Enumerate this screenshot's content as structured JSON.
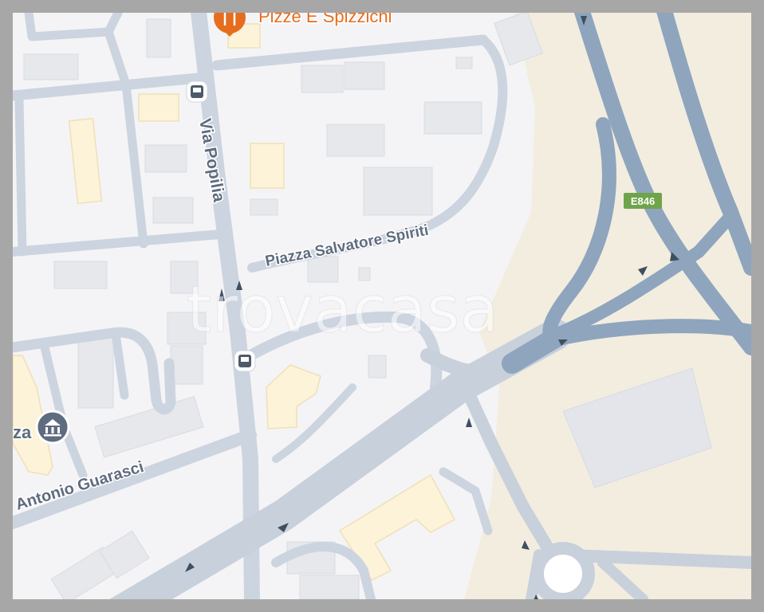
{
  "map": {
    "labels": {
      "top_poi": "Pizze E Spizzichi",
      "via_popilia": "Via Popilia",
      "piazza": "Piazza Salvatore Spiriti",
      "guarasci": "Antonio Guarasci",
      "left_fragment": "za"
    },
    "highway_shield": "E846",
    "watermark": "trovacasa",
    "colors": {
      "background": "#f4f4f6",
      "industrial_area": "#f3ede0",
      "highway": "#8ea5bd",
      "road": "#ccd4df",
      "building": "#e6e8ec",
      "building_highlight": "#fcf3d9",
      "label": "#5f6b7e",
      "poi_orange": "#e66d1e",
      "shield_green": "#6fa44a",
      "bus_icon": "#4d5a6c"
    }
  }
}
